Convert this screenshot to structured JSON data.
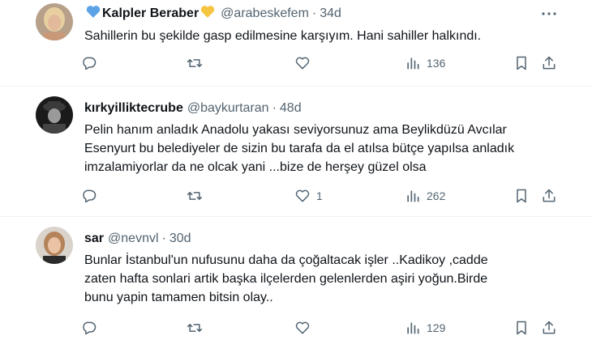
{
  "tweets": [
    {
      "name": "Kalpler Beraber",
      "handle": "@arabeskefem",
      "time": "34d",
      "text": "Sahillerin bu şekilde gasp edilmesine karşıyım. Hani sahiller halkındı.",
      "replies": "",
      "retweets": "",
      "likes": "",
      "views": "136",
      "avatar_icon": "avatar-blonde-woman",
      "name_emojis": [
        "blue-heart-emoji",
        "yellow-heart-emoji"
      ]
    },
    {
      "name": "kırkyilliktecrube",
      "handle": "@baykurtaran",
      "time": "48d",
      "text": "Pelin hanım anladık Anadolu yakası seviyorsunuz ama Beylikdüzü Avcılar\nEsenyurt bu belediyeler de  sizin bu tarafa da el atılsa bütçe yapılsa anladık\nimzalamiyorlar da ne olcak yani ...bize de herşey güzel olsa",
      "replies": "",
      "retweets": "",
      "likes": "1",
      "views": "262",
      "avatar_icon": "avatar-man-in-hat"
    },
    {
      "name": "sar",
      "handle": "@nevnvl",
      "time": "30d",
      "text": "Bunlar İstanbul'un nufusunu daha da çoğaltacak işler ..Kadikoy ,cadde\nzaten hafta sonlari artik başka ilçelerden gelenlerden aşiri yoğun.Birde\nbunu yapin tamamen bitsin olay..",
      "replies": "",
      "retweets": "",
      "likes": "",
      "views": "129",
      "avatar_icon": "avatar-woman-portrait"
    }
  ],
  "colors": {
    "text": "#0f1419",
    "secondary": "#536471",
    "divider": "#eff3f4",
    "blue_heart": "#5ba3e6",
    "yellow_heart": "#f5c542"
  }
}
